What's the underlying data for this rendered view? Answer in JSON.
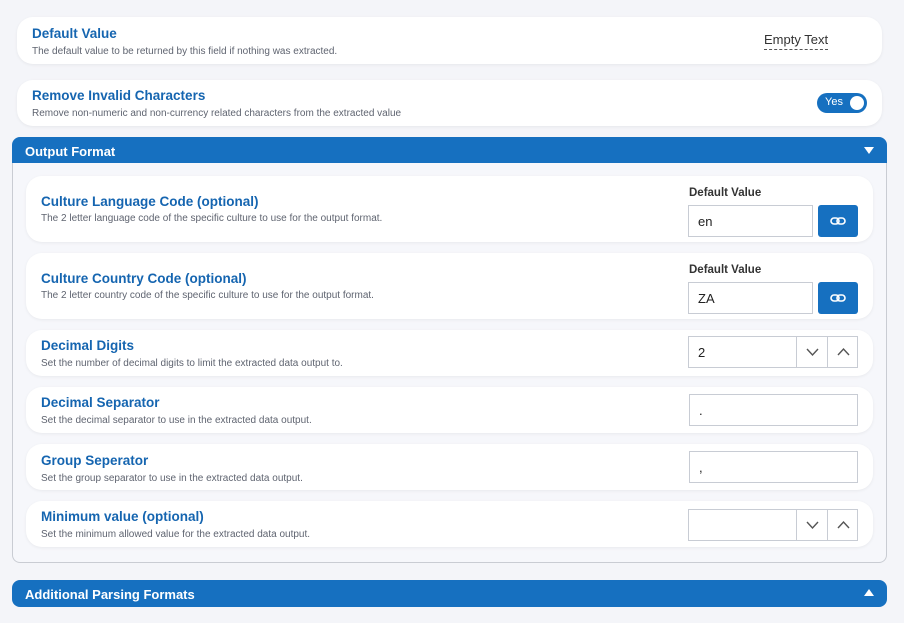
{
  "default_value": {
    "title": "Default Value",
    "description": "The default value to be returned by this field if nothing was extracted.",
    "value": "Empty Text"
  },
  "remove_invalid": {
    "title": "Remove Invalid Characters",
    "description": "Remove non-numeric and non-currency related characters from the extracted value",
    "toggle_label": "Yes",
    "toggle_on": true
  },
  "output_format": {
    "header": "Output Format",
    "expanded": true,
    "fields": {
      "culture_language": {
        "title": "Culture Language Code (optional)",
        "description": "The 2 letter language code of the specific culture to use for the output format.",
        "input_label": "Default Value",
        "value": "en"
      },
      "culture_country": {
        "title": "Culture Country Code (optional)",
        "description": "The 2 letter country code of the specific culture to use for the output format.",
        "input_label": "Default Value",
        "value": "ZA"
      },
      "decimal_digits": {
        "title": "Decimal Digits",
        "description": "Set the number of decimal digits to limit the extracted data output to.",
        "value": "2"
      },
      "decimal_separator": {
        "title": "Decimal Separator",
        "description": "Set the decimal separator to use in the extracted data output.",
        "value": "."
      },
      "group_separator": {
        "title": "Group Seperator",
        "description": "Set the group separator to use in the extracted data output.",
        "value": ","
      },
      "minimum_value": {
        "title": "Minimum value (optional)",
        "description": "Set the minimum allowed value for the extracted data output.",
        "value": ""
      }
    }
  },
  "additional_parsing": {
    "header": "Additional Parsing Formats",
    "expanded": false
  },
  "colors": {
    "accent": "#1670c0",
    "title_text": "#1565b0",
    "background": "#f4f5f9"
  },
  "icons": {
    "link": "link-icon",
    "chevron_down": "chevron-down-icon",
    "chevron_up": "chevron-up-icon",
    "caret_down": "caret-down-icon",
    "caret_up": "caret-up-icon"
  }
}
